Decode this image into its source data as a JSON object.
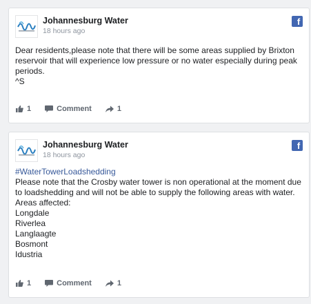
{
  "posts": [
    {
      "author": "Johannesburg Water",
      "time": "18 hours ago",
      "lines": [
        "Dear residents,please note that there will be some areas supplied by Brixton reservoir that will experience low pressure or no water especially during peak periods.",
        "^S"
      ],
      "likes": "1",
      "comment_label": "Comment",
      "shares": "1"
    },
    {
      "author": "Johannesburg Water",
      "time": "18 hours ago",
      "hashtag": "#WaterTowerLoadshedding",
      "lines": [
        "Please note that the Crosby water tower is non operational at the moment due to loadshedding and will not be able to supply the following areas with water.",
        "Areas affected:",
        "Longdale",
        "Riverlea",
        "Langlaagte",
        "Bosmont",
        "Idustria"
      ],
      "likes": "1",
      "comment_label": "Comment",
      "shares": "1"
    }
  ],
  "icons": {
    "platform": "facebook-icon",
    "like": "thumbs-up-icon",
    "comment": "comment-bubble-icon",
    "share": "share-arrow-icon"
  },
  "colors": {
    "facebook_blue": "#4267b2",
    "hashtag": "#365899",
    "background": "#f0f1f3"
  }
}
